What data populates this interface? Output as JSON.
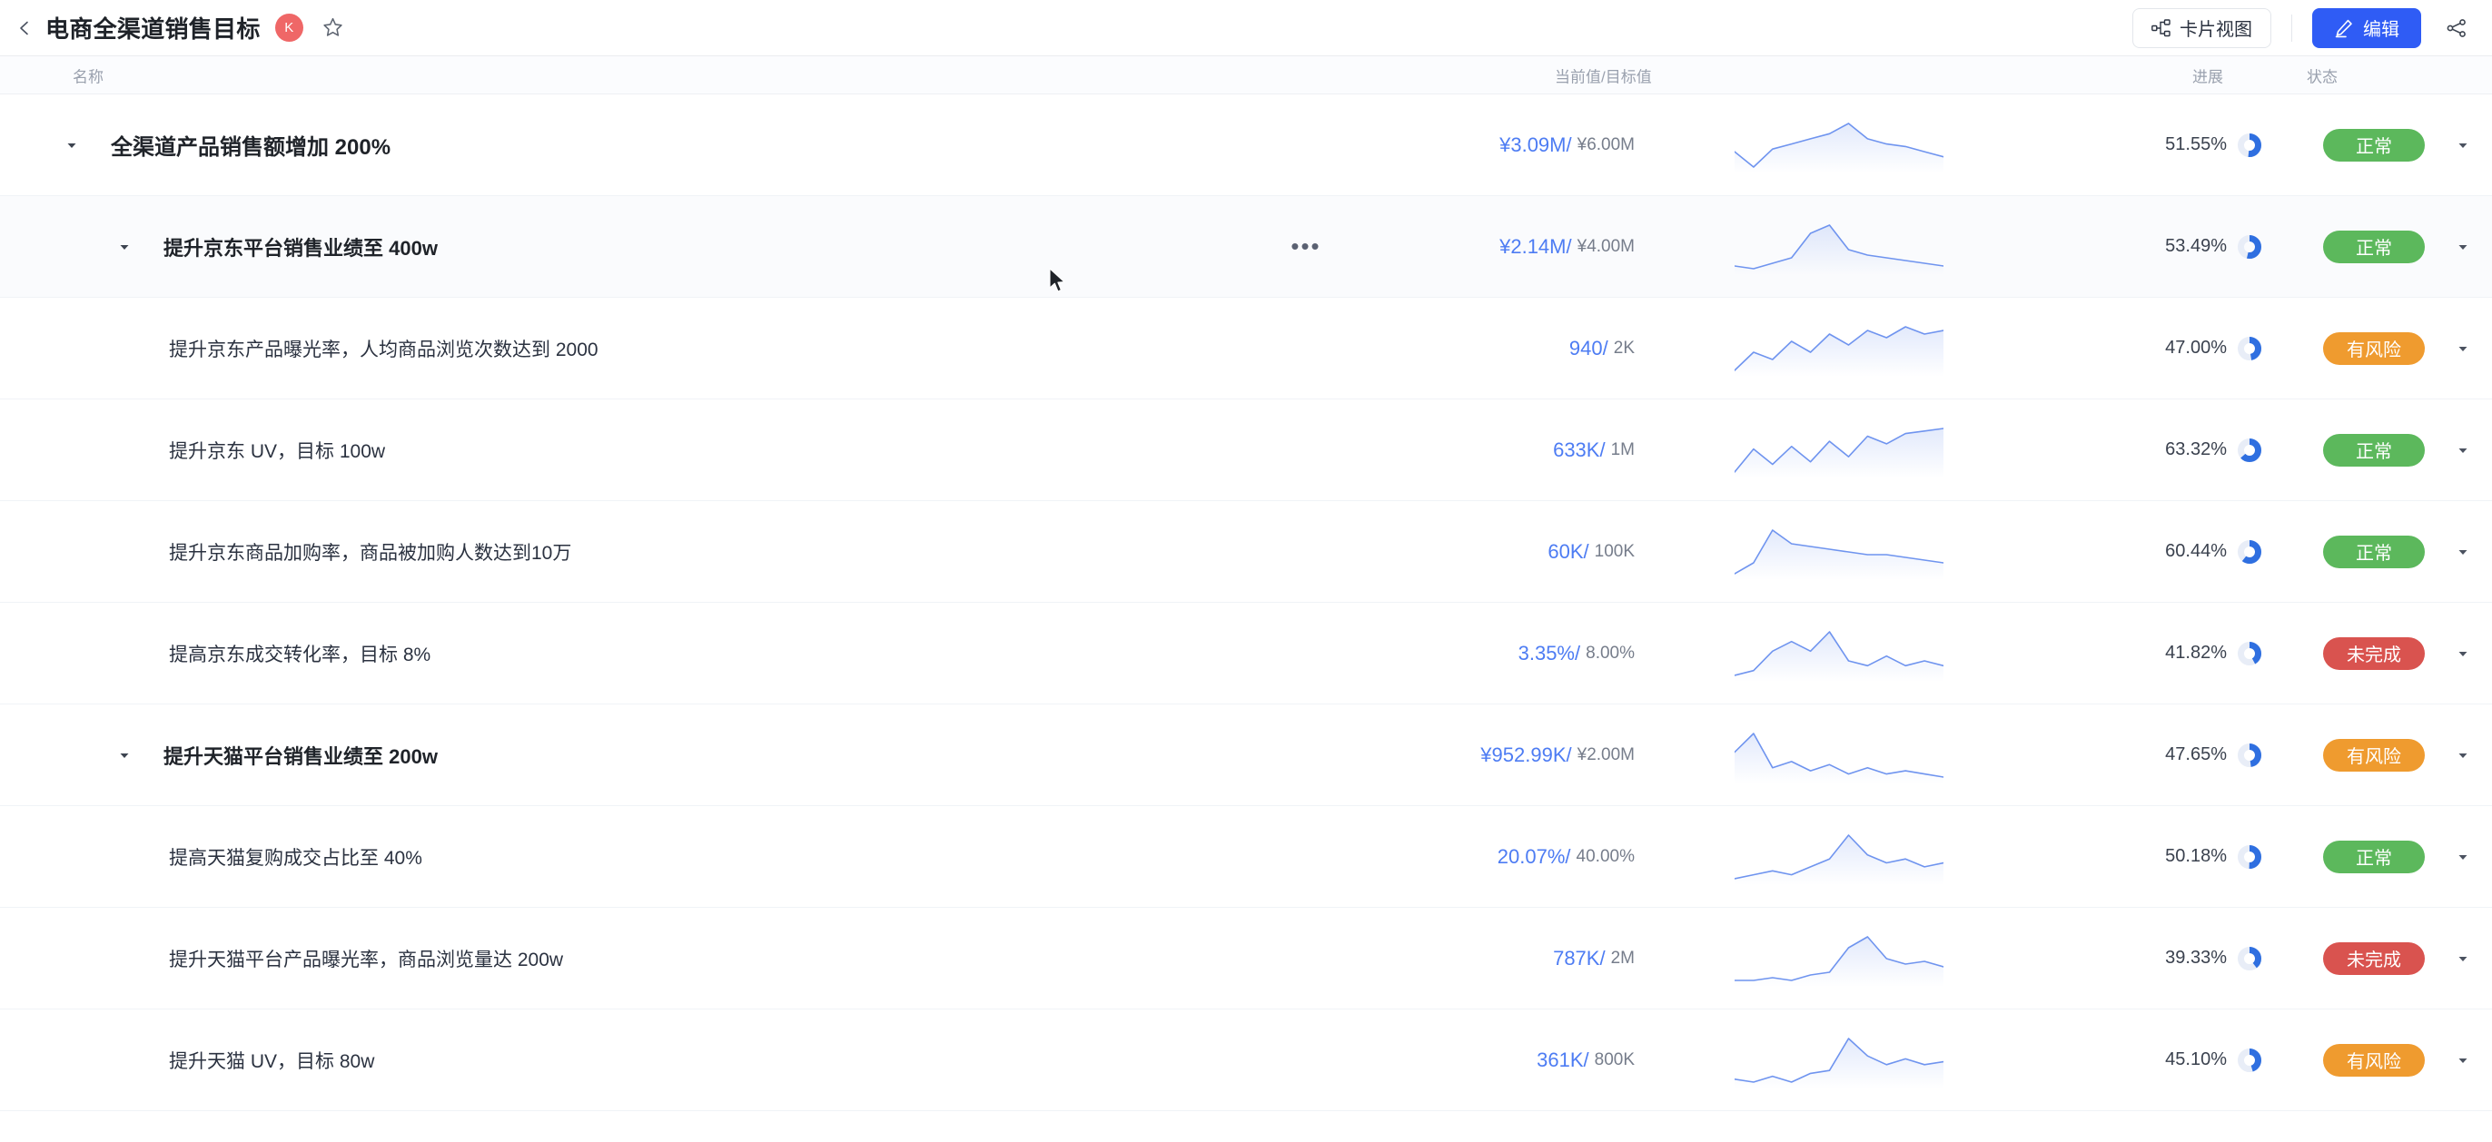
{
  "topbar": {
    "back_icon": "chevron-left-icon",
    "title": "电商全渠道销售目标",
    "avatar_initial": "K",
    "star_icon": "star-outline-icon",
    "card_view_label": "卡片视图",
    "card_view_icon": "sitemap-icon",
    "edit_label": "编辑",
    "edit_icon": "pencil-icon",
    "share_icon": "share-icon"
  },
  "columns": {
    "name": "名称",
    "value": "当前值/目标值",
    "progress": "进展",
    "status": "状态"
  },
  "statuses": {
    "normal": {
      "label": "正常",
      "color": "#5cb85c"
    },
    "risk": {
      "label": "有风险",
      "color": "#ef9b2f"
    },
    "incomplete": {
      "label": "未完成",
      "color": "#d9534f"
    }
  },
  "accent": {
    "primary_blue": "#2f5cf5",
    "value_blue": "#4d7cf3",
    "avatar_red": "#ef6767",
    "spark_line": "#6f94ef"
  },
  "rows": [
    {
      "level": 1,
      "expanded": true,
      "name": "全渠道产品销售额增加 200%",
      "current": "¥3.09M",
      "target": "¥6.00M",
      "progress": "51.55%",
      "progress_value": 51.55,
      "status_key": "normal",
      "status_label": "正常",
      "status_color": "#5cb85c",
      "spark": [
        40,
        52,
        38,
        34,
        30,
        26,
        18,
        30,
        34,
        36,
        40,
        44
      ],
      "hovered": false,
      "has_more": false
    },
    {
      "level": 2,
      "expanded": true,
      "name": "提升京东平台销售业绩至 400w",
      "current": "¥2.14M",
      "target": "¥4.00M",
      "progress": "53.49%",
      "progress_value": 53.49,
      "status_key": "normal",
      "status_label": "正常",
      "status_color": "#5cb85c",
      "spark": [
        46,
        48,
        44,
        40,
        22,
        16,
        34,
        38,
        40,
        42,
        44,
        46
      ],
      "hovered": true,
      "has_more": true
    },
    {
      "level": 3,
      "expanded": false,
      "name": "提升京东产品曝光率，人均商品浏览次数达到 2000",
      "current": "940",
      "target": "2K",
      "progress": "47.00%",
      "progress_value": 47.0,
      "status_key": "risk",
      "status_label": "有风险",
      "status_color": "#ef9b2f",
      "spark": [
        50,
        40,
        44,
        34,
        40,
        30,
        36,
        28,
        32,
        26,
        30,
        28
      ],
      "hovered": false,
      "has_more": false
    },
    {
      "level": 3,
      "expanded": false,
      "name": "提升京东 UV，目标 100w",
      "current": "633K",
      "target": "1M",
      "progress": "63.32%",
      "progress_value": 63.32,
      "status_key": "normal",
      "status_label": "正常",
      "status_color": "#5cb85c",
      "spark": [
        48,
        30,
        42,
        28,
        40,
        24,
        36,
        20,
        26,
        18,
        16,
        14
      ],
      "hovered": false,
      "has_more": false
    },
    {
      "level": 3,
      "expanded": false,
      "name": "提升京东商品加购率，商品被加购人数达到10万",
      "current": "60K",
      "target": "100K",
      "progress": "60.44%",
      "progress_value": 60.44,
      "status_key": "normal",
      "status_label": "正常",
      "status_color": "#5cb85c",
      "spark": [
        48,
        40,
        16,
        26,
        28,
        30,
        32,
        34,
        34,
        36,
        38,
        40
      ],
      "hovered": false,
      "has_more": false
    },
    {
      "level": 3,
      "expanded": false,
      "name": "提高京东成交转化率，目标 8%",
      "current": "3.35%",
      "target": "8.00%",
      "progress": "41.82%",
      "progress_value": 41.82,
      "status_key": "incomplete",
      "status_label": "未完成",
      "status_color": "#d9534f",
      "spark": [
        44,
        42,
        34,
        30,
        34,
        26,
        38,
        40,
        36,
        40,
        38,
        40
      ],
      "hovered": false,
      "has_more": false
    },
    {
      "level": 2,
      "expanded": true,
      "name": "提升天猫平台销售业绩至 200w",
      "current": "¥952.99K",
      "target": "¥2.00M",
      "progress": "47.65%",
      "progress_value": 47.65,
      "status_key": "risk",
      "status_label": "有风险",
      "status_color": "#ef9b2f",
      "spark": [
        30,
        18,
        40,
        36,
        42,
        38,
        44,
        40,
        44,
        42,
        44,
        46
      ],
      "hovered": false,
      "has_more": false
    },
    {
      "level": 3,
      "expanded": false,
      "name": "提高天猫复购成交占比至 40%",
      "current": "20.07%",
      "target": "40.00%",
      "progress": "50.18%",
      "progress_value": 50.18,
      "status_key": "normal",
      "status_label": "正常",
      "status_color": "#5cb85c",
      "spark": [
        46,
        44,
        42,
        44,
        40,
        36,
        24,
        34,
        38,
        36,
        40,
        38
      ],
      "hovered": false,
      "has_more": false
    },
    {
      "level": 3,
      "expanded": false,
      "name": "提升天猫平台产品曝光率，商品浏览量达 200w",
      "current": "787K",
      "target": "2M",
      "progress": "39.33%",
      "progress_value": 39.33,
      "status_key": "incomplete",
      "status_label": "未完成",
      "status_color": "#d9534f",
      "spark": [
        46,
        46,
        44,
        46,
        42,
        40,
        22,
        14,
        30,
        34,
        32,
        36
      ],
      "hovered": false,
      "has_more": false
    },
    {
      "level": 3,
      "expanded": false,
      "name": "提升天猫 UV，目标 80w",
      "current": "361K",
      "target": "800K",
      "progress": "45.10%",
      "progress_value": 45.1,
      "status_key": "risk",
      "status_label": "有风险",
      "status_color": "#ef9b2f",
      "spark": [
        44,
        46,
        42,
        46,
        40,
        38,
        16,
        28,
        34,
        30,
        34,
        32
      ],
      "hovered": false,
      "has_more": false
    }
  ]
}
